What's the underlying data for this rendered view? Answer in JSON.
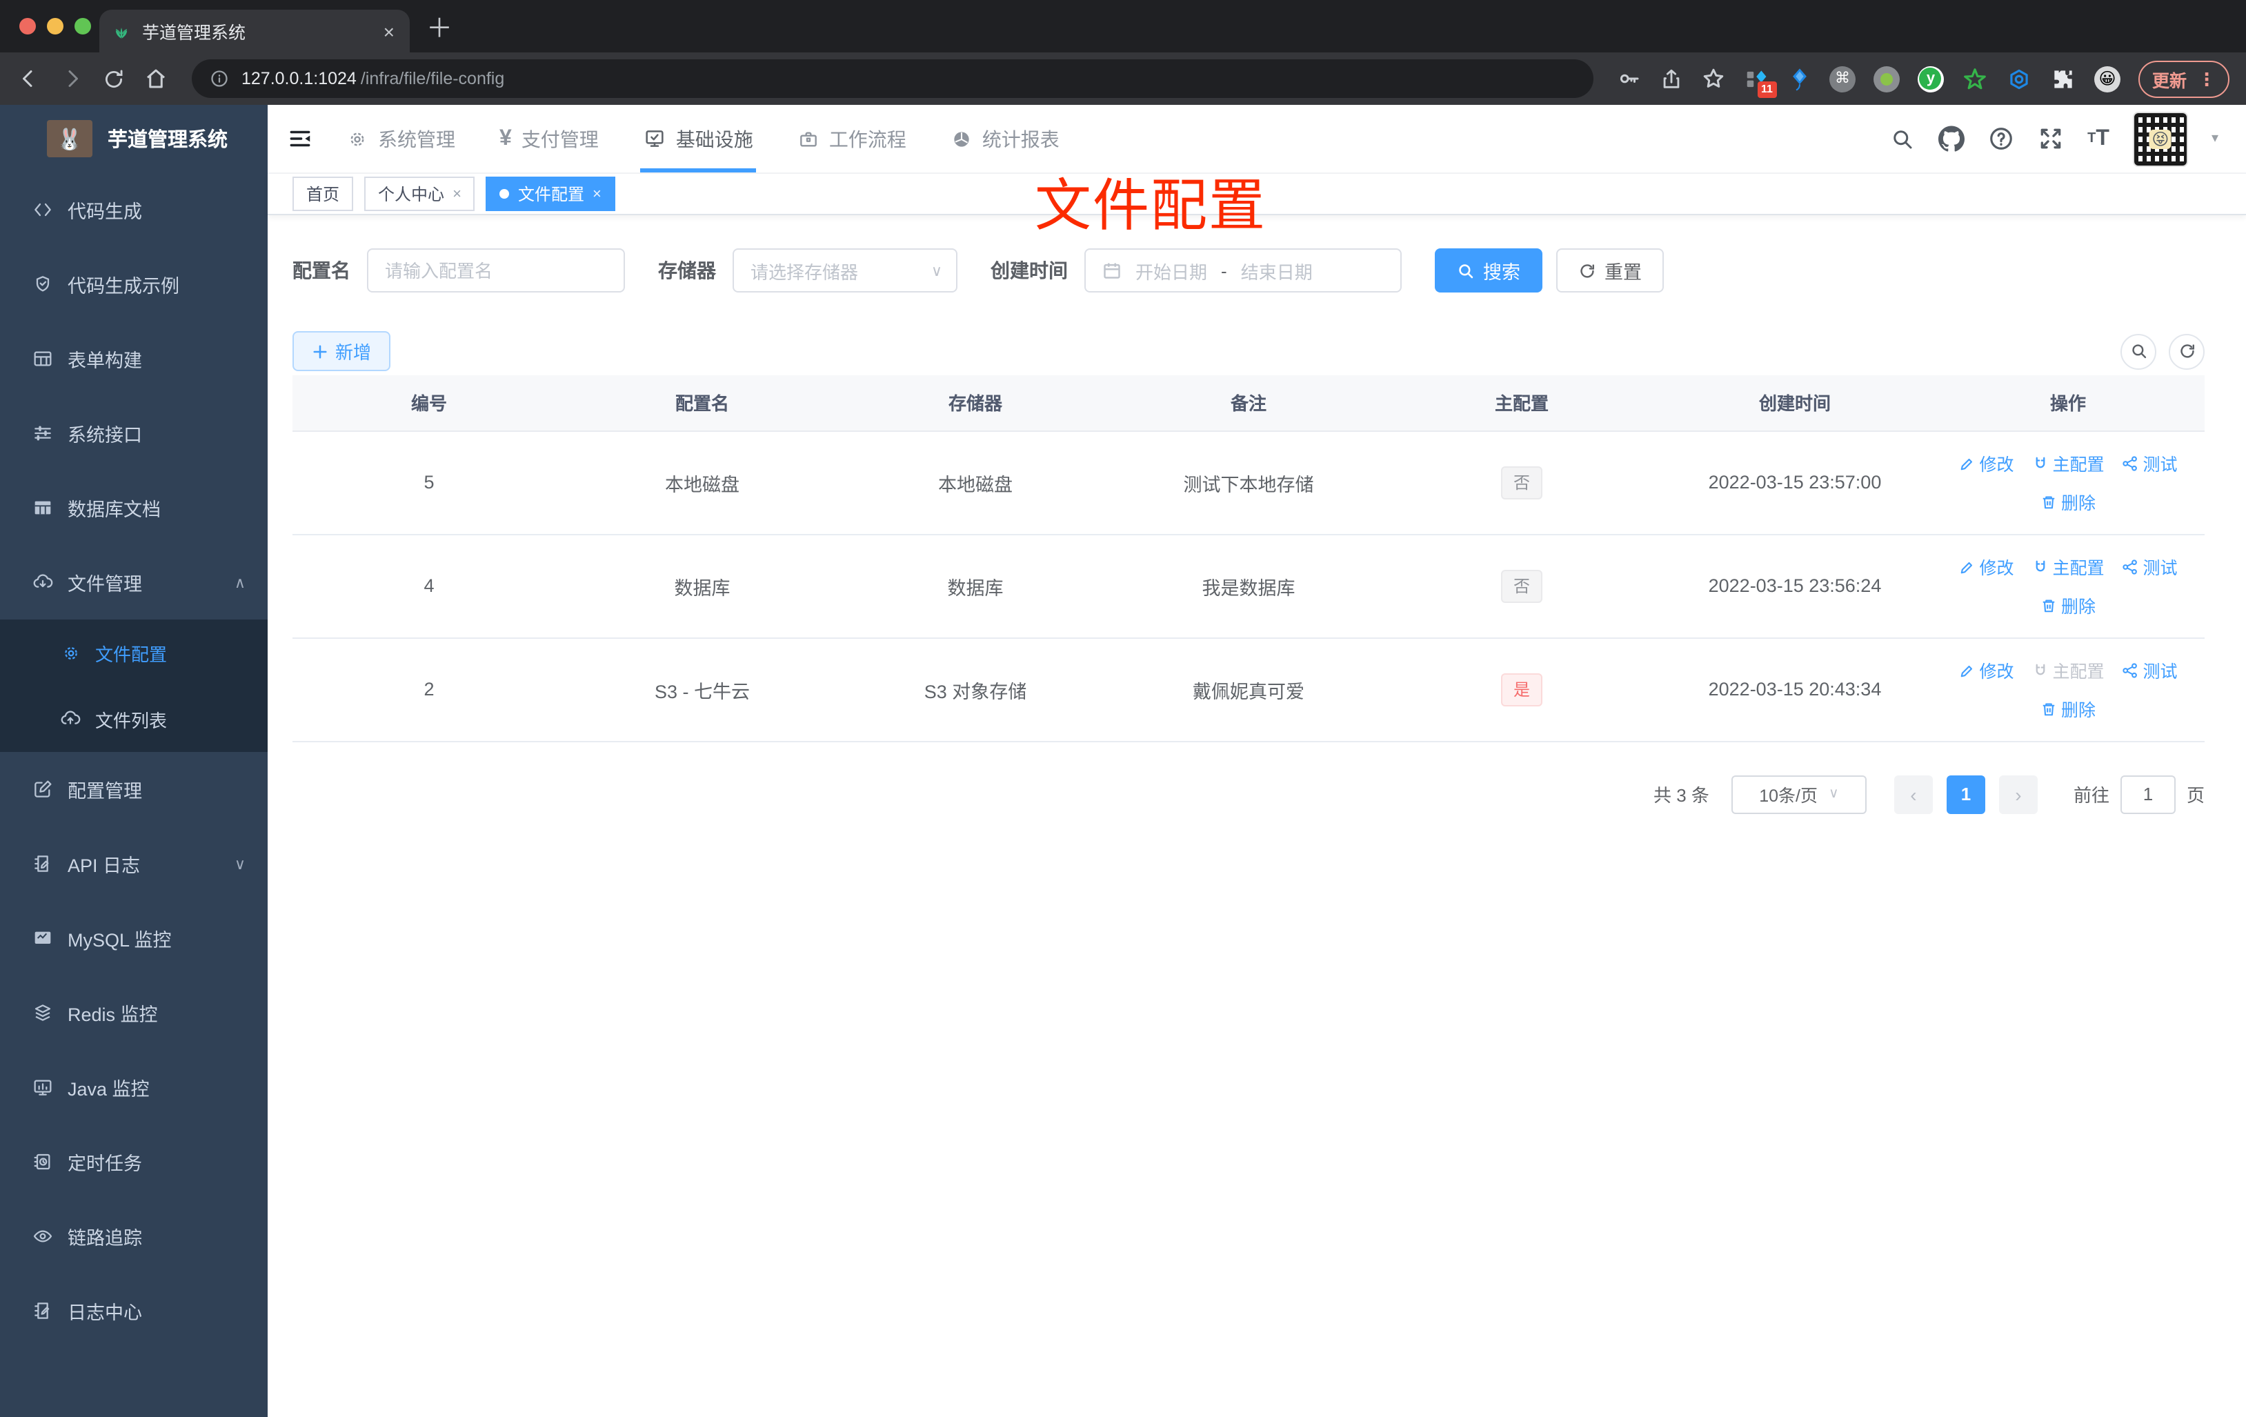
{
  "browser": {
    "tab_title": "芋道管理系统",
    "url_host": "127.0.0.1:1024",
    "url_path": "/infra/file/file-config",
    "update_label": "更新",
    "ext_badge": "11",
    "ext_cmd": "⌘",
    "ext_y": "y",
    "ext_emoji": "😀"
  },
  "sidebar": {
    "title": "芋道管理系统",
    "logo_emoji": "🐰",
    "items": [
      {
        "label": "代码生成"
      },
      {
        "label": "代码生成示例"
      },
      {
        "label": "表单构建"
      },
      {
        "label": "系统接口"
      },
      {
        "label": "数据库文档"
      },
      {
        "label": "文件管理",
        "children": [
          {
            "label": "文件配置"
          },
          {
            "label": "文件列表"
          }
        ]
      },
      {
        "label": "配置管理"
      },
      {
        "label": "API 日志"
      },
      {
        "label": "MySQL 监控"
      },
      {
        "label": "Redis 监控"
      },
      {
        "label": "Java 监控"
      },
      {
        "label": "定时任务"
      },
      {
        "label": "链路追踪"
      },
      {
        "label": "日志中心"
      }
    ]
  },
  "topnav": {
    "items": [
      {
        "label": "系统管理"
      },
      {
        "label": "支付管理"
      },
      {
        "label": "基础设施"
      },
      {
        "label": "工作流程"
      },
      {
        "label": "统计报表"
      }
    ]
  },
  "tabs": [
    {
      "label": "首页"
    },
    {
      "label": "个人中心"
    },
    {
      "label": "文件配置"
    }
  ],
  "overlay_title": "文件配置",
  "filters": {
    "name_label": "配置名",
    "name_placeholder": "请输入配置名",
    "storage_label": "存储器",
    "storage_placeholder": "请选择存储器",
    "date_label": "创建时间",
    "date_start_placeholder": "开始日期",
    "date_separator": "-",
    "date_end_placeholder": "结束日期",
    "search_label": "搜索",
    "reset_label": "重置"
  },
  "toolbar": {
    "add_label": "新增"
  },
  "table": {
    "headers": [
      "编号",
      "配置名",
      "存储器",
      "备注",
      "主配置",
      "创建时间",
      "操作"
    ],
    "actions": {
      "edit": "修改",
      "master": "主配置",
      "test": "测试",
      "delete": "删除"
    },
    "rows": [
      {
        "id": "5",
        "name": "本地磁盘",
        "storage": "本地磁盘",
        "remark": "测试下本地存储",
        "master": "否",
        "created": "2022-03-15 23:57:00"
      },
      {
        "id": "4",
        "name": "数据库",
        "storage": "数据库",
        "remark": "我是数据库",
        "master": "否",
        "created": "2022-03-15 23:56:24"
      },
      {
        "id": "2",
        "name": "S3 - 七牛云",
        "storage": "S3 对象存储",
        "remark": "戴佩妮真可爱",
        "master": "是",
        "created": "2022-03-15 20:43:34"
      }
    ]
  },
  "pagination": {
    "total": "共 3 条",
    "page_size": "10条/页",
    "prev": "‹",
    "page": "1",
    "next": "›",
    "goto": "前往",
    "goto_value": "1",
    "unit": "页"
  },
  "glyphs": {
    "close": "×",
    "plus": "＋",
    "yen": "¥",
    "chevron_up": "∧",
    "chevron_down": "∨",
    "caret_down": "▾",
    "kebab": "⋮",
    "newtab": "＋"
  },
  "colors": {
    "accent": "#409eff",
    "sidebar_bg": "#304156",
    "submenu_bg": "#1f2d3d",
    "overlay_red": "#fb2b00",
    "tag_info_text": "#909399",
    "tag_danger_text": "#f56c6c"
  }
}
